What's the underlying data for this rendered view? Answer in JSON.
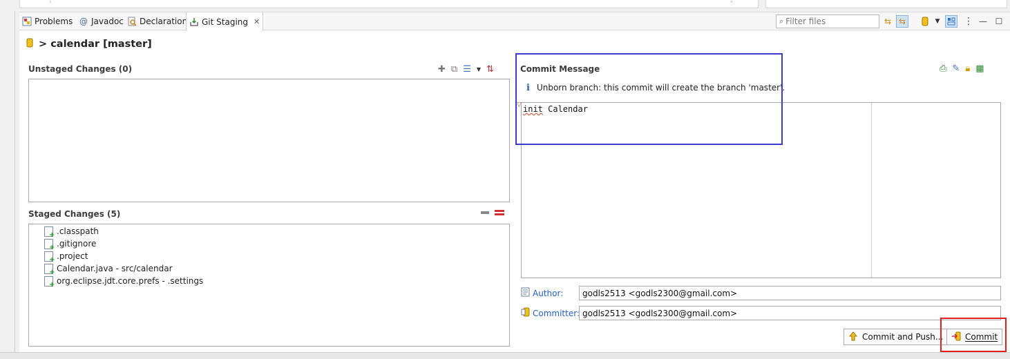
{
  "tabs": [
    {
      "label": "Problems",
      "icon": "problems-icon"
    },
    {
      "label": "Javadoc",
      "icon": "javadoc-icon"
    },
    {
      "label": "Declaration",
      "icon": "declaration-icon"
    },
    {
      "label": "Git Staging",
      "icon": "git-staging-icon",
      "active": true
    }
  ],
  "toolbar": {
    "filter_placeholder": "Filter files"
  },
  "repo": {
    "title": "> calendar [master]"
  },
  "unstaged": {
    "header": "Unstaged Changes (0)",
    "files": []
  },
  "staged": {
    "header": "Staged Changes (5)",
    "files": [
      {
        "name": ".classpath",
        "icon": "xml-file-added-icon"
      },
      {
        "name": ".gitignore",
        "icon": "text-file-added-icon"
      },
      {
        "name": ".project",
        "icon": "xml-file-added-icon"
      },
      {
        "name": "Calendar.java - src/calendar",
        "icon": "java-file-added-icon"
      },
      {
        "name": "org.eclipse.jdt.core.prefs - .settings",
        "icon": "text-file-added-icon"
      }
    ]
  },
  "commit": {
    "header": "Commit Message",
    "info": "Unborn branch: this commit will create the branch 'master'.",
    "message_word1": "init",
    "message_rest": " Calendar",
    "author_label": "Author:",
    "author_value": "godls2513 <godls2300@gmail.com>",
    "committer_label": "Committer:",
    "committer_value": "godls2513 <godls2300@gmail.com>",
    "commit_and_push_label": "Commit and Push...",
    "commit_label": "Commit"
  },
  "colors": {
    "highlight_blue": "#3a3acb",
    "highlight_red": "#e02020",
    "link_blue": "#2060c0",
    "added_green": "#1b9e1b"
  }
}
